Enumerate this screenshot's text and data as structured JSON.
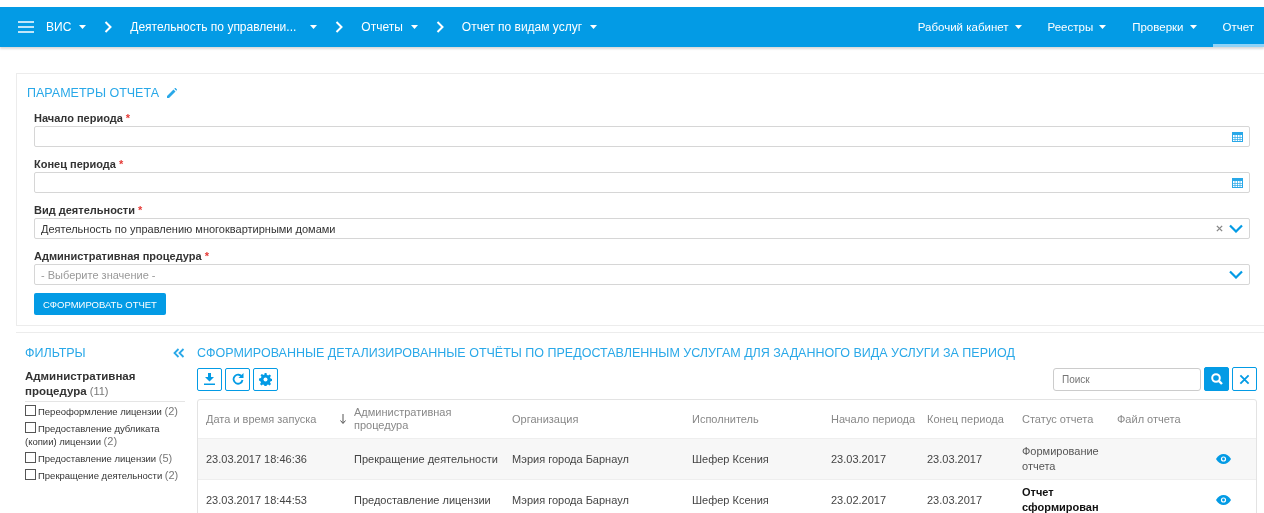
{
  "nav": {
    "breadcrumbs": [
      {
        "label": "ВИС"
      },
      {
        "label": "Деятельность по управлени..."
      },
      {
        "label": "Отчеты"
      },
      {
        "label": "Отчет по видам услуг"
      }
    ],
    "menu": [
      {
        "label": "Рабочий кабинет",
        "selected": false
      },
      {
        "label": "Реестры",
        "selected": false
      },
      {
        "label": "Проверки",
        "selected": false
      },
      {
        "label": "Отчет",
        "selected": true
      }
    ]
  },
  "params": {
    "title": "ПАРАМЕТРЫ ОТЧЕТА",
    "fields": [
      {
        "kind": "date",
        "label": "Начало периода",
        "mark": "*"
      },
      {
        "kind": "date",
        "label": "Конец периода",
        "mark": "*"
      },
      {
        "kind": "select",
        "label": "Вид деятельности",
        "mark": "*",
        "value": "Деятельность по управлению многоквартирными домами"
      },
      {
        "kind": "select",
        "label": "Административная процедура",
        "mark": "*",
        "placeholder": "- Выберите значение -"
      }
    ],
    "submit": "СФОРМИРОВАТЬ ОТЧЕТ"
  },
  "filters": {
    "title": "ФИЛЬТРЫ",
    "group": {
      "title": "Административная процедура",
      "count": "(11)",
      "options": [
        {
          "label": "Переоформление лицензии",
          "count": "(2)",
          "checked": false
        },
        {
          "label": "Предоставление дубликата (копии) лицензии",
          "count": "(2)",
          "checked": false
        },
        {
          "label": "Предоставление лицензии",
          "count": "(5)",
          "checked": false
        },
        {
          "label": "Прекращение деятельности",
          "count": "(2)",
          "checked": false
        }
      ]
    }
  },
  "table": {
    "title": "СФОРМИРОВАННЫЕ ДЕТАЛИЗИРОВАННЫЕ ОТЧЁТЫ ПО ПРЕДОСТАВЛЕННЫМ УСЛУГАМ ДЛЯ ЗАДАННОГО ВИДА УСЛУГИ ЗА ПЕРИОД",
    "search_placeholder": "Поиск",
    "columns": [
      {
        "label": "Дата и время запуска",
        "sorted": true
      },
      {
        "label": "Административная процедура",
        "sorted": false
      },
      {
        "label": "Организация",
        "sorted": false
      },
      {
        "label": "Исполнитель",
        "sorted": false
      },
      {
        "label": "Начало периода",
        "sorted": false
      },
      {
        "label": "Конец периода",
        "sorted": false
      },
      {
        "label": "Статус отчета",
        "sorted": false
      },
      {
        "label": "Файл отчета",
        "sorted": false
      }
    ],
    "rows": [
      {
        "cells": [
          "23.03.2017 18:46:36",
          "Прекращение деятельности",
          "Мэрия города Барнаул",
          "Шефер Ксения",
          "23.03.2017",
          "23.03.2017",
          "Формирование отчета"
        ],
        "done": false
      },
      {
        "cells": [
          "23.03.2017 18:44:53",
          "Предоставление лицензии",
          "Мэрия города Барнаул",
          "Шефер Ксения",
          "23.02.2017",
          "23.03.2017",
          "Отчет сформирован"
        ],
        "done": true
      }
    ]
  }
}
